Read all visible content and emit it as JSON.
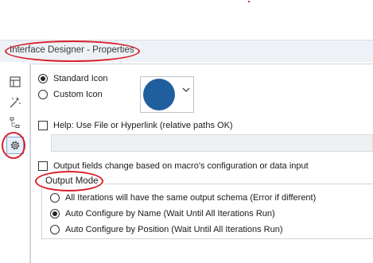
{
  "window": {
    "title": "Interface Designer - Properties"
  },
  "sidebar": {
    "items": [
      {
        "name": "layout",
        "icon": "layout-icon",
        "active": false
      },
      {
        "name": "wizard",
        "icon": "magic-wand-icon",
        "active": false
      },
      {
        "name": "test",
        "icon": "tree-icon",
        "active": false
      },
      {
        "name": "properties",
        "icon": "gear-icon",
        "active": true
      }
    ]
  },
  "icon_section": {
    "standard_label": "Standard Icon",
    "custom_label": "Custom Icon",
    "selected": "standard",
    "icon_color": "#1f5f9e"
  },
  "help": {
    "label": "Help: Use File or Hyperlink (relative paths OK)",
    "checked": false,
    "path_value": ""
  },
  "output_fields": {
    "label": "Output fields change based on macro's configuration or data input",
    "checked": false
  },
  "output_mode": {
    "title": "Output Mode",
    "options": [
      {
        "label": "All Iterations will have the same output schema (Error if different)",
        "selected": false
      },
      {
        "label": "Auto Configure by Name (Wait Until All Iterations Run)",
        "selected": true
      },
      {
        "label": "Auto Configure by Position (Wait Until All Iterations Run)",
        "selected": false
      }
    ]
  },
  "colors": {
    "annotation": "#d9202a",
    "accent": "#1f5f9e"
  }
}
